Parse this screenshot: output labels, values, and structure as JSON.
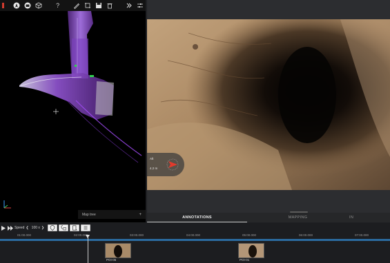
{
  "viewer": {
    "toolbar": {
      "help_label": "?"
    },
    "map_tree_label": "Map tree",
    "map_tree_add": "+"
  },
  "media": {
    "overlay_line1": "Alt",
    "overlay_line2": "4.2 m"
  },
  "tabs": [
    {
      "label": "ANNOTATIONS",
      "active": true
    },
    {
      "label": "MAPPING",
      "active": false
    },
    {
      "label": "IN",
      "active": false
    }
  ],
  "controls": {
    "speed_label": "Speed",
    "speed_prev": "❮",
    "speed_value": "100 x",
    "speed_next": "❯"
  },
  "timeline": {
    "ticks": [
      "01:00.000",
      "02:00.000",
      "03:00.000",
      "04:00.000",
      "05:00.000",
      "06:00.000",
      "07:00.000"
    ],
    "pois": [
      "POI-05",
      "POI-01"
    ]
  },
  "colors": {
    "timeline_track": "#2b6ba0",
    "pointcloud": "#a84dff",
    "heading_arrow": "#e23a2c"
  }
}
